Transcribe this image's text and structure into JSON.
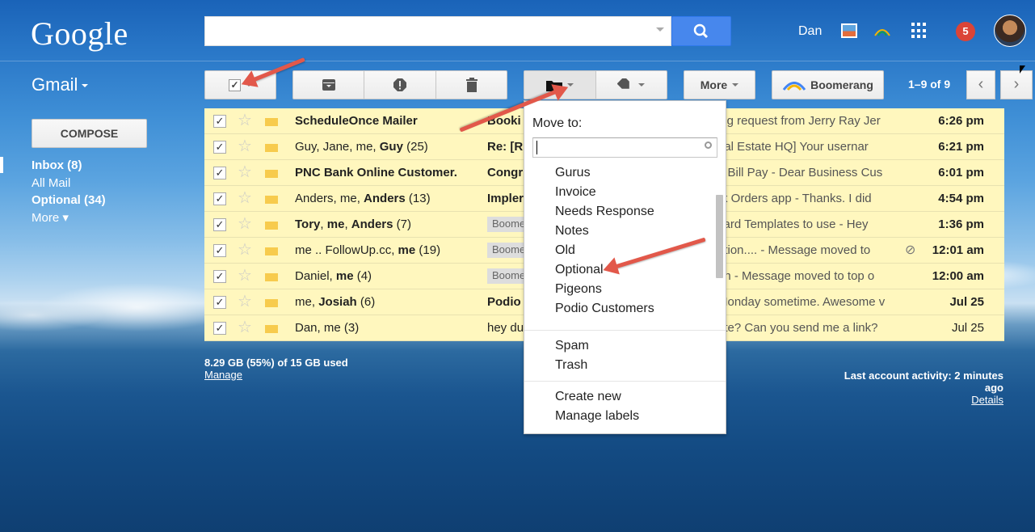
{
  "brand": {
    "logo": "Google",
    "product": "Gmail"
  },
  "search": {
    "value": "",
    "placeholder": ""
  },
  "account": {
    "name": "Dan",
    "notifications": "5"
  },
  "toolbar": {
    "more_label": "More",
    "boomerang_label": "Boomerang",
    "pager": "1–9 of 9"
  },
  "sidebar": {
    "compose": "COMPOSE",
    "items": [
      {
        "label": "Inbox (8)",
        "bold": true
      },
      {
        "label": "All Mail",
        "bold": false
      },
      {
        "label": "Optional (34)",
        "bold": true
      },
      {
        "label": "More ▾",
        "bold": true
      }
    ]
  },
  "emails": [
    {
      "sender": "ScheduleOnce Mailer",
      "subject": "Booki",
      "tag": "",
      "snippet": "ing request from Jerry Ray Jer",
      "clip": false,
      "date": "6:26 pm",
      "date_bold": true
    },
    {
      "sender": "Guy, Jane, me, Guy (25)",
      "subject": "Re: [R",
      "tag": "",
      "snippet": "eal Estate HQ] Your usernar",
      "clip": false,
      "date": "6:21 pm",
      "date_bold": true
    },
    {
      "sender": "PNC Bank Online Customer.",
      "subject": "Congr",
      "tag": "",
      "snippet": "e Bill Pay - Dear Business Cus",
      "clip": false,
      "date": "6:01 pm",
      "date_bold": true
    },
    {
      "sender": "Anders, me, Anders (13)",
      "subject": "Impler",
      "tag": "",
      "snippet": "rk Orders app - Thanks. I did",
      "clip": false,
      "date": "4:54 pm",
      "date_bold": true
    },
    {
      "sender": "Tory, me, Anders (7)",
      "subject": "",
      "tag": "Boome",
      "snippet": "card Templates to use - Hey",
      "clip": false,
      "date": "1:36 pm",
      "date_bold": true
    },
    {
      "sender": "me .. FollowUp.cc, me (19)",
      "subject": "",
      "tag": "Boome",
      "snippet": "ation.... - Message moved to",
      "clip": true,
      "date": "12:01 am",
      "date_bold": true
    },
    {
      "sender": "Daniel, me (4)",
      "subject": "",
      "tag": "Boome",
      "snippet": "on - Message moved to top o",
      "clip": false,
      "date": "12:00 am",
      "date_bold": true
    },
    {
      "sender": "me, Josiah (6)",
      "subject": "Podio",
      "tag": "",
      "snippet": "Monday sometime. Awesome v",
      "clip": false,
      "date": "Jul 25",
      "date_bold": true
    },
    {
      "sender": "Dan, me (3)",
      "subject": "hey du",
      "tag": "",
      "snippet": "ate? Can you send me a link?",
      "clip": false,
      "date": "Jul 25",
      "date_bold": false
    }
  ],
  "storage": {
    "usage": "8.29 GB (55%) of 15 GB used",
    "manage": "Manage"
  },
  "activity": {
    "text": "Last account activity: 2 minutes ago",
    "details": "Details"
  },
  "move_menu": {
    "title": "Move to:",
    "search_value": "",
    "labels": [
      "Gurus",
      "Invoice",
      "Needs Response",
      "Notes",
      "Old",
      "Optional",
      "Pigeons",
      "Podio Customers"
    ],
    "system": [
      "Spam",
      "Trash"
    ],
    "actions": [
      "Create new",
      "Manage labels"
    ]
  },
  "colors": {
    "row_bg": "#fff7be",
    "accent_blue": "#4787ed",
    "arrow": "#e2584a",
    "label_yellow": "#f7cb4d"
  }
}
